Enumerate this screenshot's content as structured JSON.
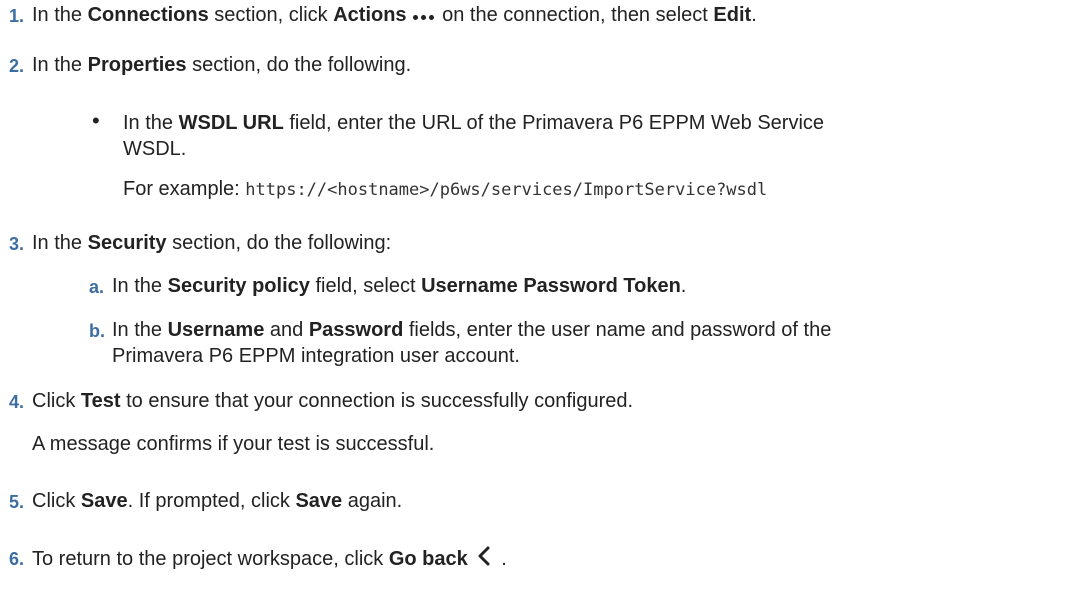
{
  "steps": [
    {
      "number": "1.",
      "prefix": "In the ",
      "bold1": "Connections",
      "mid1": " section, click ",
      "bold2": "Actions",
      "mid2": " on the connection, then select ",
      "bold3": "Edit",
      "suffix": "."
    },
    {
      "number": "2.",
      "prefix": "In the ",
      "bold1": "Properties",
      "suffix": " section, do the following."
    },
    {
      "number": "3.",
      "prefix": "In the ",
      "bold1": "Security",
      "suffix": " section, do the following:"
    },
    {
      "number": "4.",
      "prefix": "Click ",
      "bold1": "Test",
      "suffix": " to ensure that your connection is successfully configured.",
      "note": "A message confirms if your test is successful."
    },
    {
      "number": "5.",
      "prefix": "Click ",
      "bold1": "Save",
      "mid1": ". If prompted, click ",
      "bold2": "Save",
      "suffix": " again."
    },
    {
      "number": "6.",
      "prefix": "To return to the project workspace, click ",
      "bold1": "Go back",
      "suffix": " ."
    }
  ],
  "properties_bullet": {
    "prefix": "In the ",
    "bold": "WSDL URL",
    "line1_suffix": " field, enter the URL of the Primavera P6 EPPM Web Service",
    "line2": "WSDL.",
    "example_label": "For example: ",
    "example_code": "https://<hostname>/p6ws/services/ImportService?wsdl"
  },
  "security_substeps": [
    {
      "letter": "a.",
      "prefix": "In the ",
      "bold1": "Security policy",
      "mid1": " field, select ",
      "bold2": "Username Password Token",
      "suffix": "."
    },
    {
      "letter": "b.",
      "prefix": "In the ",
      "bold1": "Username",
      "mid1": " and ",
      "bold2": "Password",
      "line1_suffix": " fields, enter the user name and password of the",
      "line2": "Primavera P6 EPPM integration user account."
    }
  ],
  "icons": {
    "actions": "more-actions-icon",
    "go_back": "chevron-left-icon",
    "bullet": "bullet-icon"
  },
  "colors": {
    "numbering": "#3c6da3",
    "text": "#222222"
  }
}
